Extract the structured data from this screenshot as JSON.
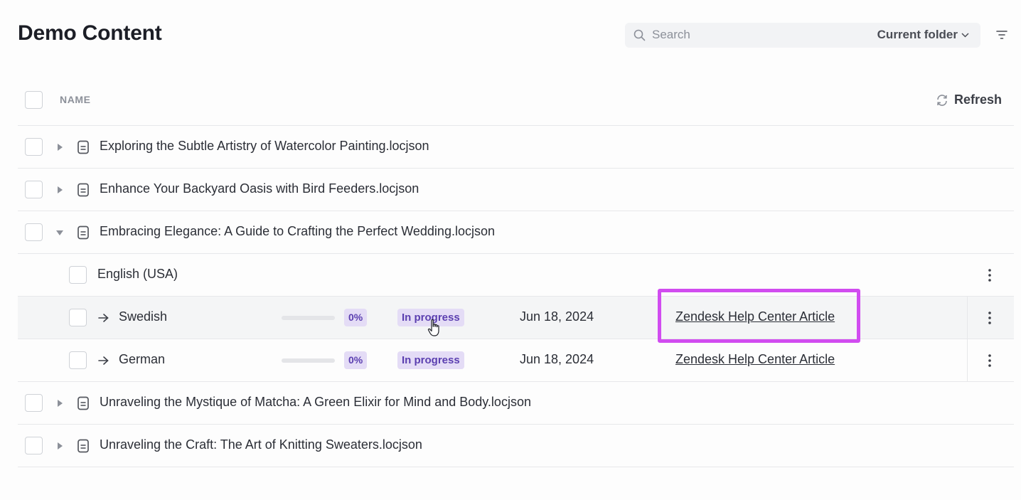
{
  "page": {
    "title": "Demo Content"
  },
  "search": {
    "placeholder": "Search",
    "scope": "Current folder"
  },
  "table": {
    "header": {
      "name": "NAME",
      "refresh": "Refresh"
    },
    "rows": [
      {
        "name": "Exploring the Subtle Artistry of Watercolor Painting.locjson",
        "expanded": false
      },
      {
        "name": "Enhance Your Backyard Oasis with Bird Feeders.locjson",
        "expanded": false
      },
      {
        "name": "Embracing Elegance: A Guide to Crafting the Perfect Wedding.locjson",
        "expanded": true,
        "source_language": "English (USA)",
        "targets": [
          {
            "language": "Swedish",
            "progress": 0,
            "progress_label": "0%",
            "status": "In progress",
            "date": "Jun 18, 2024",
            "link": "Zendesk Help Center Article"
          },
          {
            "language": "German",
            "progress": 0,
            "progress_label": "0%",
            "status": "In progress",
            "date": "Jun 18, 2024",
            "link": "Zendesk Help Center Article"
          }
        ]
      },
      {
        "name": "Unraveling the Mystique of Matcha: A Green Elixir for Mind and Body.locjson",
        "expanded": false
      },
      {
        "name": "Unraveling the Craft: The Art of Knitting Sweaters.locjson",
        "expanded": false
      }
    ]
  },
  "colors": {
    "accent": "#7c5cd6",
    "badge_bg": "#e4dcf6",
    "badge_text": "#5b3fb0",
    "highlight": "#d14cf0"
  }
}
